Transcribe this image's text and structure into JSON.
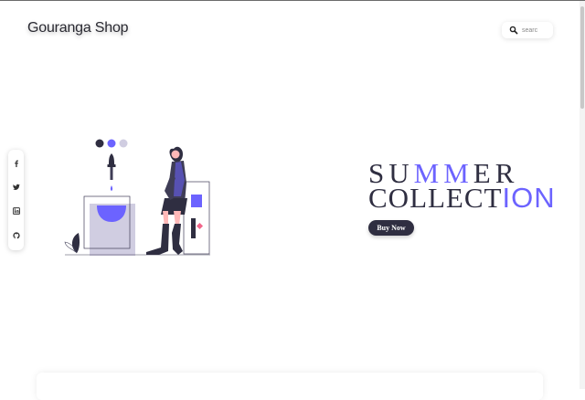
{
  "header": {
    "brand": "Gouranga Shop",
    "search": {
      "placeholder": "searc",
      "icon": "search-icon"
    }
  },
  "social": [
    {
      "name": "facebook",
      "icon": "facebook-icon"
    },
    {
      "name": "twitter",
      "icon": "twitter-icon"
    },
    {
      "name": "linkedin",
      "icon": "linkedin-icon"
    },
    {
      "name": "github",
      "icon": "github-icon"
    }
  ],
  "hero": {
    "title_line1_a": "SU",
    "title_line1_b": "MM",
    "title_line1_c": "ER",
    "title_line2_a": "COLLECT",
    "title_line2_b": "ION",
    "cta": "Buy Now"
  },
  "colors": {
    "accent": "#6c63ff",
    "dark": "#2f2e41",
    "pink": "#f2668b"
  }
}
